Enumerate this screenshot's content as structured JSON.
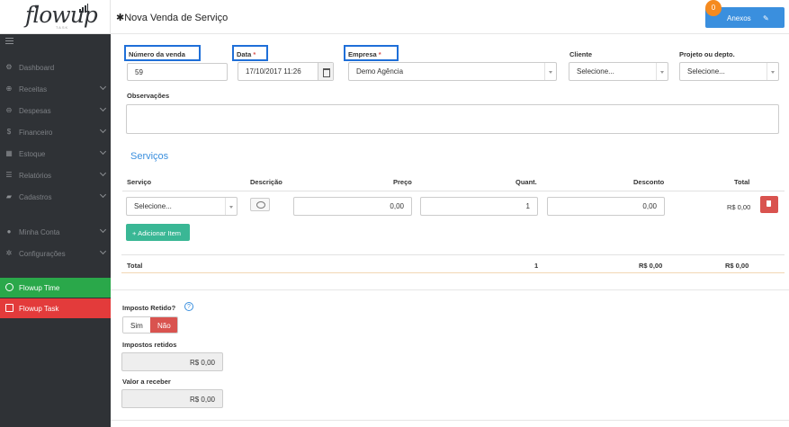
{
  "colors": {
    "sidebar_bg": "#2f3236",
    "primary": "#3a8fde",
    "success": "#2aa84a",
    "danger": "#e33b3b",
    "teal": "#3ab795",
    "badge": "#f58a1f"
  },
  "logo": {
    "text": "flowup",
    "sub": "TASK"
  },
  "sidebar": {
    "items": [
      {
        "label": "Dashboard",
        "icon": "dashboard-icon",
        "glyph": "⚙"
      },
      {
        "label": "Receitas",
        "icon": "plus-circle-icon",
        "glyph": "⊕"
      },
      {
        "label": "Despesas",
        "icon": "minus-circle-icon",
        "glyph": "⊖"
      },
      {
        "label": "Financeiro",
        "icon": "dollar-icon",
        "glyph": "$"
      },
      {
        "label": "Estoque",
        "icon": "grid-icon",
        "glyph": "▦"
      },
      {
        "label": "Relatórios",
        "icon": "list-icon",
        "glyph": "☰"
      },
      {
        "label": "Cadastros",
        "icon": "folder-icon",
        "glyph": "▰"
      },
      {
        "label": "Minha Conta",
        "icon": "user-icon",
        "glyph": "●"
      },
      {
        "label": "Configurações",
        "icon": "cogs-icon",
        "glyph": "✲"
      }
    ],
    "time_label": "Flowup Time",
    "task_label": "Flowup Task"
  },
  "header": {
    "icon": "✱",
    "title": "Nova Venda de Serviço",
    "attachments_label": "Anexos",
    "attachments_count": "0"
  },
  "form": {
    "numero_label": "Número da venda",
    "numero_value": "59",
    "data_label": "Data",
    "data_value": "17/10/2017 11:26",
    "empresa_label": "Empresa",
    "empresa_value": "Demo Agência",
    "cliente_label": "Cliente",
    "cliente_value": "Selecione...",
    "projeto_label": "Projeto ou depto.",
    "projeto_value": "Selecione...",
    "obs_label": "Observações",
    "required_mark": "*"
  },
  "servicos": {
    "title": "Serviços",
    "headers": {
      "servico": "Serviço",
      "descricao": "Descrição",
      "preco": "Preço",
      "quant": "Quant.",
      "desconto": "Desconto",
      "total": "Total"
    },
    "row": {
      "servico": "Selecione...",
      "preco": "0,00",
      "quant": "1",
      "desconto": "0,00",
      "total": "R$ 0,00"
    },
    "add_label": "Adicionar Item",
    "add_icon": "+",
    "totals": {
      "label": "Total",
      "quant": "1",
      "desconto": "R$ 0,00",
      "total": "R$ 0,00"
    }
  },
  "impostos": {
    "retido_label": "Imposto Retido?",
    "help": "?",
    "sim": "Sim",
    "nao": "Não",
    "retidos_label": "Impostos retidos",
    "retidos_value": "R$ 0,00",
    "receber_label": "Valor a receber",
    "receber_value": "R$ 0,00"
  }
}
